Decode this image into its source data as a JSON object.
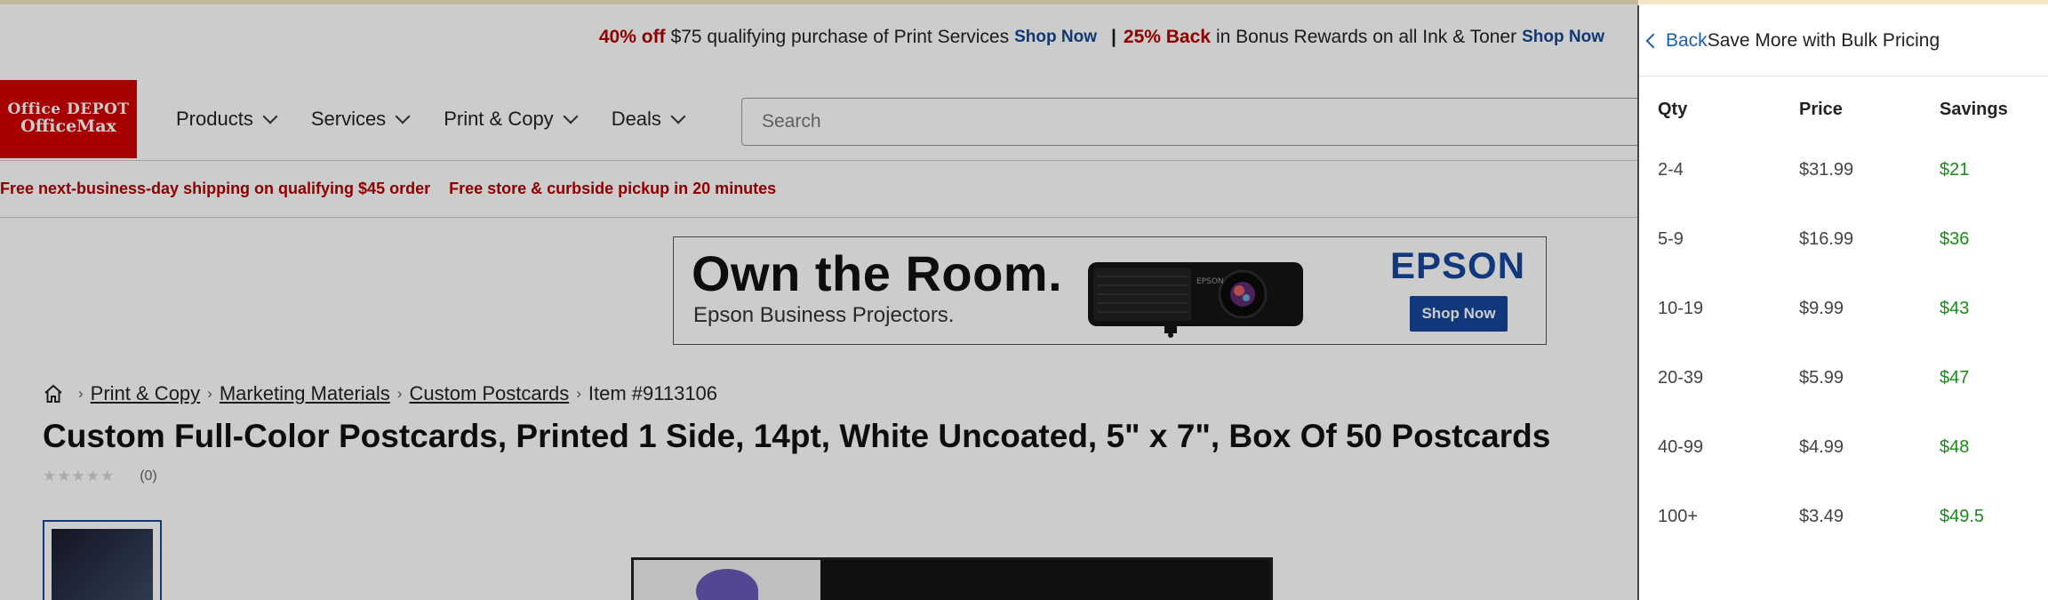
{
  "promo": {
    "part1_strong": "40% off",
    "part1_text": "$75 qualifying purchase of Print Services",
    "part1_link": "Shop Now",
    "divider": "|",
    "part2_strong": "25% Back",
    "part2_text": "in Bonus Rewards on all Ink & Toner",
    "part2_link": "Shop Now"
  },
  "logo": {
    "line1": "Office DEPOT",
    "line2": "OfficeMax"
  },
  "nav": [
    "Products",
    "Services",
    "Print & Copy",
    "Deals"
  ],
  "search": {
    "placeholder": "Search"
  },
  "shipping": {
    "msg1": "Free next-business-day shipping on qualifying $45 order",
    "msg2": "Free store & curbside pickup in 20 minutes"
  },
  "banner": {
    "headline": "Own the Room.",
    "subline": "Epson Business Projectors.",
    "brand": "EPSON",
    "button": "Shop Now",
    "projector_label": "EPSON"
  },
  "breadcrumbs": [
    "Print & Copy",
    "Marketing Materials",
    "Custom Postcards"
  ],
  "item_number": "Item #9113106",
  "product_title": "Custom Full-Color Postcards, Printed 1 Side, 14pt, White Uncoated, 5\" x 7\", Box Of 50 Postcards",
  "rating": {
    "stars": 0,
    "count": "(0)"
  },
  "drawer": {
    "back_label": "Back",
    "title": "Save More with Bulk Pricing",
    "headers": [
      "Qty",
      "Price",
      "Savings"
    ],
    "rows": [
      {
        "qty": "2-4",
        "price": "$31.99",
        "savings": "$21"
      },
      {
        "qty": "5-9",
        "price": "$16.99",
        "savings": "$36"
      },
      {
        "qty": "10-19",
        "price": "$9.99",
        "savings": "$43"
      },
      {
        "qty": "20-39",
        "price": "$5.99",
        "savings": "$47"
      },
      {
        "qty": "40-99",
        "price": "$4.99",
        "savings": "$48"
      },
      {
        "qty": "100+",
        "price": "$3.49",
        "savings": "$49.5"
      }
    ]
  },
  "colors": {
    "brand_red": "#d00000",
    "promo_red": "#b30000",
    "link_blue": "#17468f",
    "savings_green": "#1a8c1a"
  }
}
